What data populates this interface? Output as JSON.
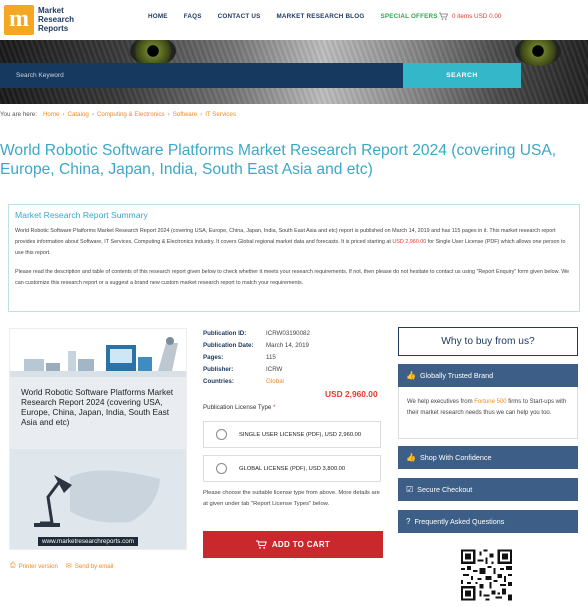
{
  "header": {
    "logo_lines": [
      "Market",
      "Research",
      "Reports"
    ],
    "logo_letter": "m",
    "nav": [
      "HOME",
      "FAQS",
      "CONTACT US",
      "MARKET RESEARCH BLOG",
      "SPECIAL OFFERS"
    ],
    "cart_text": "0 items USD 0.00"
  },
  "search": {
    "placeholder": "Search Keyword",
    "button": "SEARCH"
  },
  "breadcrumb": {
    "label": "You are here:",
    "items": [
      "Home",
      "Catalog",
      "Computing & Electronics",
      "Software",
      "IT Services"
    ]
  },
  "page_title": "World Robotic Software Platforms Market Research Report 2024 (covering USA, Europe, China, Japan, India, South East Asia and etc)",
  "summary": {
    "heading": "Market Research Report Summary",
    "p1_a": "World Robotic Software Platforms Market Research Report 2024 (covering USA, Europe, China, Japan, India, South East Asia and etc) report is published on March 14, 2019 and has 115 pages in it. This market research report provides information about Software, IT Services, Computing & Electronics industry. It covers Global regional market data and forecasts. It is priced starting at ",
    "p1_price": "USD 2,960.00",
    "p1_b": " for Single User License (PDF) which allows one person to use this report.",
    "p2": "Please read the description and table of contents of this research report given below to check whether it meets your research requirements. If not, then please do not hesitate to contact us using \"Report Enquiry\" form given below. We can customize this research report or a suggest a brand new custom market research report to match your requirements."
  },
  "cover": {
    "title": "World Robotic Software Platforms Market Research Report 2024 (covering USA, Europe, China, Japan, India, South East Asia and etc)",
    "url": "www.marketresearchreports.com"
  },
  "meta": {
    "publication_id_label": "Publication ID:",
    "publication_id": "ICRW03190082",
    "publication_date_label": "Publication Date:",
    "publication_date": "March 14, 2019",
    "pages_label": "Pages:",
    "pages": "115",
    "publisher_label": "Publisher:",
    "publisher": "ICRW",
    "countries_label": "Countries:",
    "countries": "Global"
  },
  "price": "USD 2,960.00",
  "license": {
    "type_label": "Publication License Type",
    "required_mark": "*",
    "options": [
      "SINGLE USER LICENSE (PDF), USD 2,960.00",
      "GLOBAL LICENSE (PDF), USD 3,800.00"
    ],
    "note": "Please choose the suitable license type from above. More details are at given under tab \"Report License Types\" below."
  },
  "add_to_cart": "ADD TO CART",
  "links": {
    "printer": "Printer version",
    "email": "Send by email"
  },
  "sidebar": {
    "why_title": "Why to buy from us?",
    "globally_trusted": "Globally Trusted Brand",
    "trusted_text_a": "We help executives from ",
    "trusted_text_hl": "Fortune 500",
    "trusted_text_b": " firms to Start-ups with their market research needs thus we can help you too.",
    "shop_confidence": "Shop With Confidence",
    "secure_checkout": "Secure Checkout",
    "faq": "Frequently Asked Questions"
  },
  "colors": {
    "brand_navy": "#1f3a60",
    "accent_teal": "#3aa8c8",
    "accent_orange": "#f08a24",
    "cart_red": "#c9282d",
    "sidebar_blue": "#3d5f87"
  }
}
